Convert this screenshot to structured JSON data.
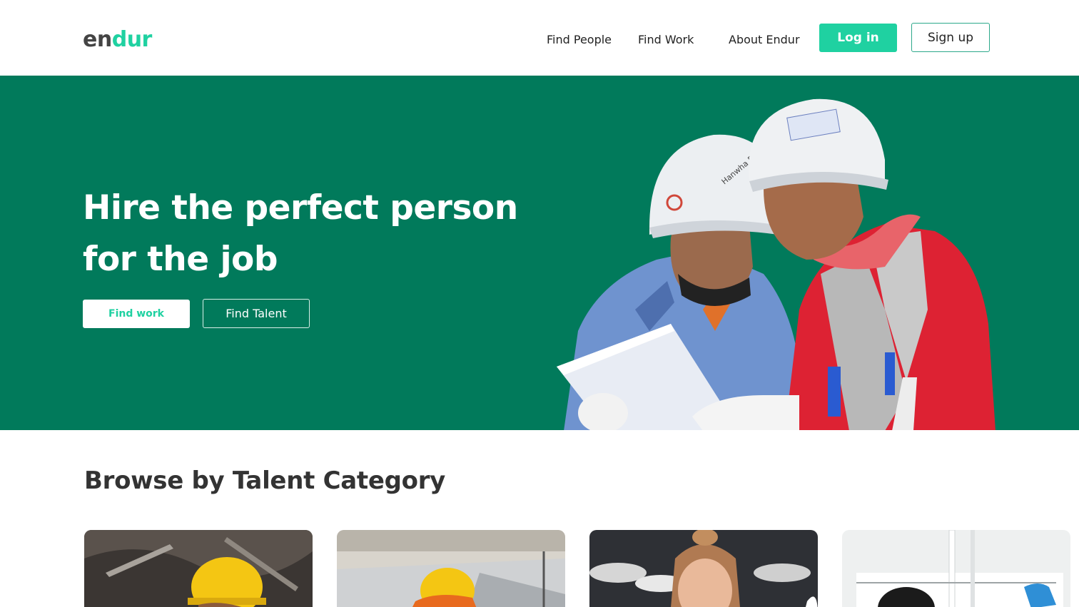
{
  "brand": {
    "logo_part1": "en",
    "logo_part2": "dur"
  },
  "nav": {
    "find_people": "Find People",
    "find_work": "Find Work",
    "about": "About Endur",
    "login": "Log in",
    "signup": "Sign up"
  },
  "hero": {
    "title": "Hire the perfect person for the job",
    "find_work_button": "Find work",
    "find_talent_button": "Find Talent",
    "helmet_label": "Hanwha E"
  },
  "browse": {
    "title": "Browse by Talent Category",
    "cards": [
      {
        "image": "worker-yellow-helmet-welding"
      },
      {
        "image": "worker-yellow-helmet-rooftop"
      },
      {
        "image": "woman-bun-hair"
      },
      {
        "image": "cleaner-window-blue-cloth"
      }
    ]
  },
  "colors": {
    "accent": "#1fd1a1",
    "hero_bg": "#017a5b",
    "text_dark": "#222222"
  }
}
